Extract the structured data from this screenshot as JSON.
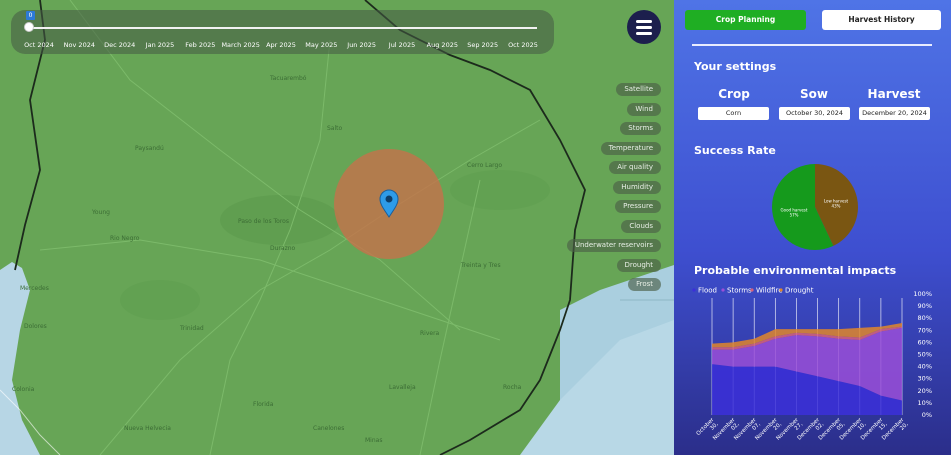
{
  "timeline": {
    "current_badge": "0",
    "months": [
      "Oct 2024",
      "Nov 2024",
      "Dec 2024",
      "Jan 2025",
      "Feb 2025",
      "March 2025",
      "Apr 2025",
      "May 2025",
      "Jun 2025",
      "Jul 2025",
      "Aug 2025",
      "Sep 2025",
      "Oct 2025"
    ]
  },
  "map": {
    "places": [
      "Tacuarembó",
      "Paysandú",
      "Young",
      "Rio Negro",
      "Paso de los Toros",
      "Durazno",
      "Mercedes",
      "Dolores",
      "Florida",
      "Treinta y Tres",
      "Cerro Largo",
      "Rocha",
      "Lavalleja",
      "Canelones",
      "Nueva Helvecia",
      "Minas",
      "Trinidad",
      "Colonia",
      "Salto",
      "Rivera"
    ],
    "selected_area_color": "#c8714a",
    "pin_color": "#2e9be8"
  },
  "layers": [
    "Satellite",
    "Wind",
    "Storms",
    "Temperature",
    "Air quality",
    "Humidity",
    "Pressure",
    "Clouds",
    "Underwater reservoirs",
    "Drought",
    "Frost"
  ],
  "panel": {
    "tabs": {
      "crop_planning": "Crop Planning",
      "harvest_history": "Harvest History"
    },
    "settings_title": "Your settings",
    "crop": {
      "label": "Crop",
      "value": "Corn"
    },
    "sow": {
      "label": "Sow",
      "value": "October 30, 2024"
    },
    "harvest": {
      "label": "Harvest",
      "value": "December 20, 2024"
    },
    "success_title": "Success Rate",
    "impacts_title": "Probable environmental impacts"
  },
  "chart_data": [
    {
      "type": "pie",
      "title": "Success Rate",
      "slices": [
        {
          "label": "Good harvest",
          "value": 57,
          "color": "#159a1c"
        },
        {
          "label": "Low harvest",
          "value": 43,
          "color": "#7a5612"
        }
      ]
    },
    {
      "type": "area",
      "title": "Probable environmental impacts",
      "stacked": true,
      "categories": [
        "October 30, 2024",
        "November 02, 2024",
        "November 07, 2024",
        "November 20, 2024",
        "November 27, 2024",
        "December 02, 2024",
        "December 05, 2024",
        "December 10, 2024",
        "December 15, 2024",
        "December 20, 2024"
      ],
      "series": [
        {
          "name": "Flood",
          "color": "#3b2fd9",
          "values": [
            42,
            40,
            40,
            40,
            36,
            32,
            28,
            24,
            16,
            12
          ]
        },
        {
          "name": "Storms",
          "color": "#9a4fd8",
          "values": [
            12,
            14,
            17,
            23,
            30,
            33,
            35,
            38,
            53,
            60
          ]
        },
        {
          "name": "Wildfire",
          "color": "#d8607a",
          "values": [
            2,
            2,
            2,
            2,
            2,
            2,
            2,
            2,
            2,
            1
          ]
        },
        {
          "name": "Drought",
          "color": "#e0862a",
          "values": [
            3,
            4,
            4,
            6,
            3,
            4,
            6,
            8,
            2,
            3
          ]
        }
      ],
      "yticks": [
        "0%",
        "10%",
        "20%",
        "30%",
        "40%",
        "50%",
        "60%",
        "70%",
        "80%",
        "90%",
        "100%"
      ],
      "ylim": [
        0,
        100
      ],
      "grid": false,
      "legend": "top-left"
    }
  ]
}
